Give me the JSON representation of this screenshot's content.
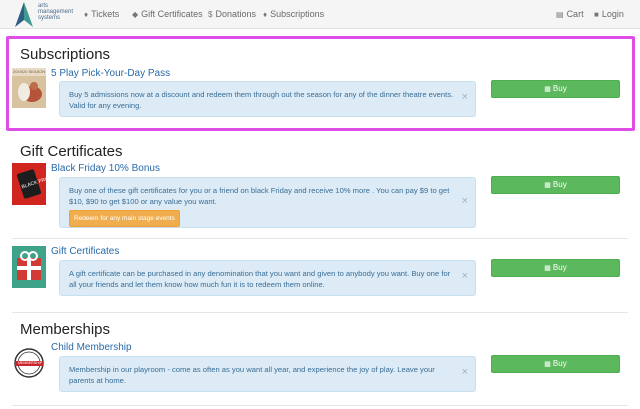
{
  "nav": {
    "logo_lines": [
      "arts",
      "management",
      "systems"
    ],
    "links": [
      {
        "label": "Tickets",
        "icon": "tag-icon"
      },
      {
        "label": "Gift Certificates",
        "icon": "gift-icon"
      },
      {
        "label": "Donations",
        "icon": "dollar-icon"
      },
      {
        "label": "Subscriptions",
        "icon": "tag-icon"
      }
    ],
    "cart": "Cart",
    "login": "Login"
  },
  "sections": [
    {
      "title": "Subscriptions",
      "items": [
        {
          "title": "5 Play Pick-Your-Day Pass",
          "thumb_caption": "2019/20 SEASON",
          "description": "Buy 5 admissions now at a discount and redeem them through out the season for any of the dinner theatre events. Valid for any evening.",
          "buy_label": "Buy"
        }
      ]
    },
    {
      "title": "Gift Certificates",
      "items": [
        {
          "title": "Black Friday 10% Bonus",
          "thumb_caption": "BLACK FRIDAY",
          "description": "Buy one of these gift certificates for you or a friend on black Friday and receive 10% more . You can pay $9 to get $10, $90 to get $100 or any value you want.",
          "extra_button": "Redeem for any main stage events",
          "buy_label": "Buy"
        },
        {
          "title": "Gift Certificates",
          "description": "A gift certificate can be purchased in any denomination that you want and given to anybody you want. Buy one for all your friends and let them know how much fun it is to redeem them online.",
          "buy_label": "Buy"
        }
      ]
    },
    {
      "title": "Memberships",
      "items": [
        {
          "title": "Child Membership",
          "thumb_caption": "MEMBERSHIP",
          "description": "Membership in our playroom - come as often as you want all year, and experience the joy of play. Leave your parents at home.",
          "buy_label": "Buy"
        }
      ]
    }
  ],
  "colors": {
    "highlight": "#e04ee8",
    "buy": "#5cb85c",
    "alert_bg": "#dcebf6",
    "link": "#2a6aa8"
  }
}
